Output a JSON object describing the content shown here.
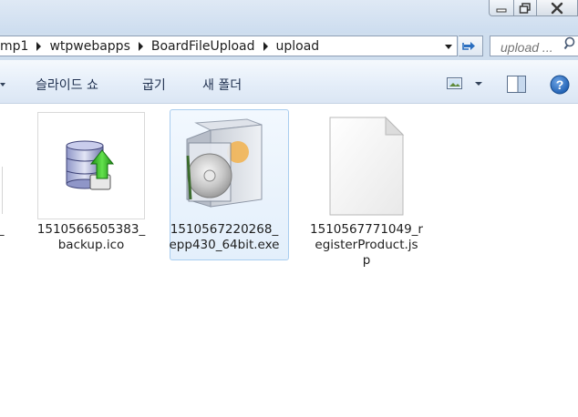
{
  "window": {
    "controls": {
      "minimize": "minimize",
      "maximize": "maximize",
      "close": "close"
    }
  },
  "address": {
    "crumbs": [
      "mp1",
      "wtpwebapps",
      "BoardFileUpload",
      "upload"
    ],
    "search_placeholder": "upload ..."
  },
  "toolbar": {
    "slideshow": "슬라이드 쇼",
    "burn": "굽기",
    "new_folder": "새 폴더",
    "help": "?"
  },
  "files": [
    {
      "name": "1510566505383_backup.ico",
      "label_lines": [
        "1510566505383_",
        "backup.ico"
      ],
      "icon": "database-upload-icon",
      "selected": false
    },
    {
      "name": "1510567220268_epp430_64bit.exe",
      "label_lines": [
        "1510567220268_",
        "epp430_64bit.exe"
      ],
      "icon": "software-box-cd-icon",
      "selected": true
    },
    {
      "name": "1510567771049_registerProduct.jsp",
      "label_lines": [
        "1510567771049_r",
        "egisterProduct.js",
        "p"
      ],
      "icon": "blank-document-icon",
      "selected": false
    }
  ],
  "partial_label": "_",
  "colors": {
    "titlebar": "#dfe9f5",
    "toolbar": "#e5eef9",
    "selection_border": "#a9cdef",
    "selection_fill": "#e3effb",
    "help_blue": "#1f5fb2"
  }
}
